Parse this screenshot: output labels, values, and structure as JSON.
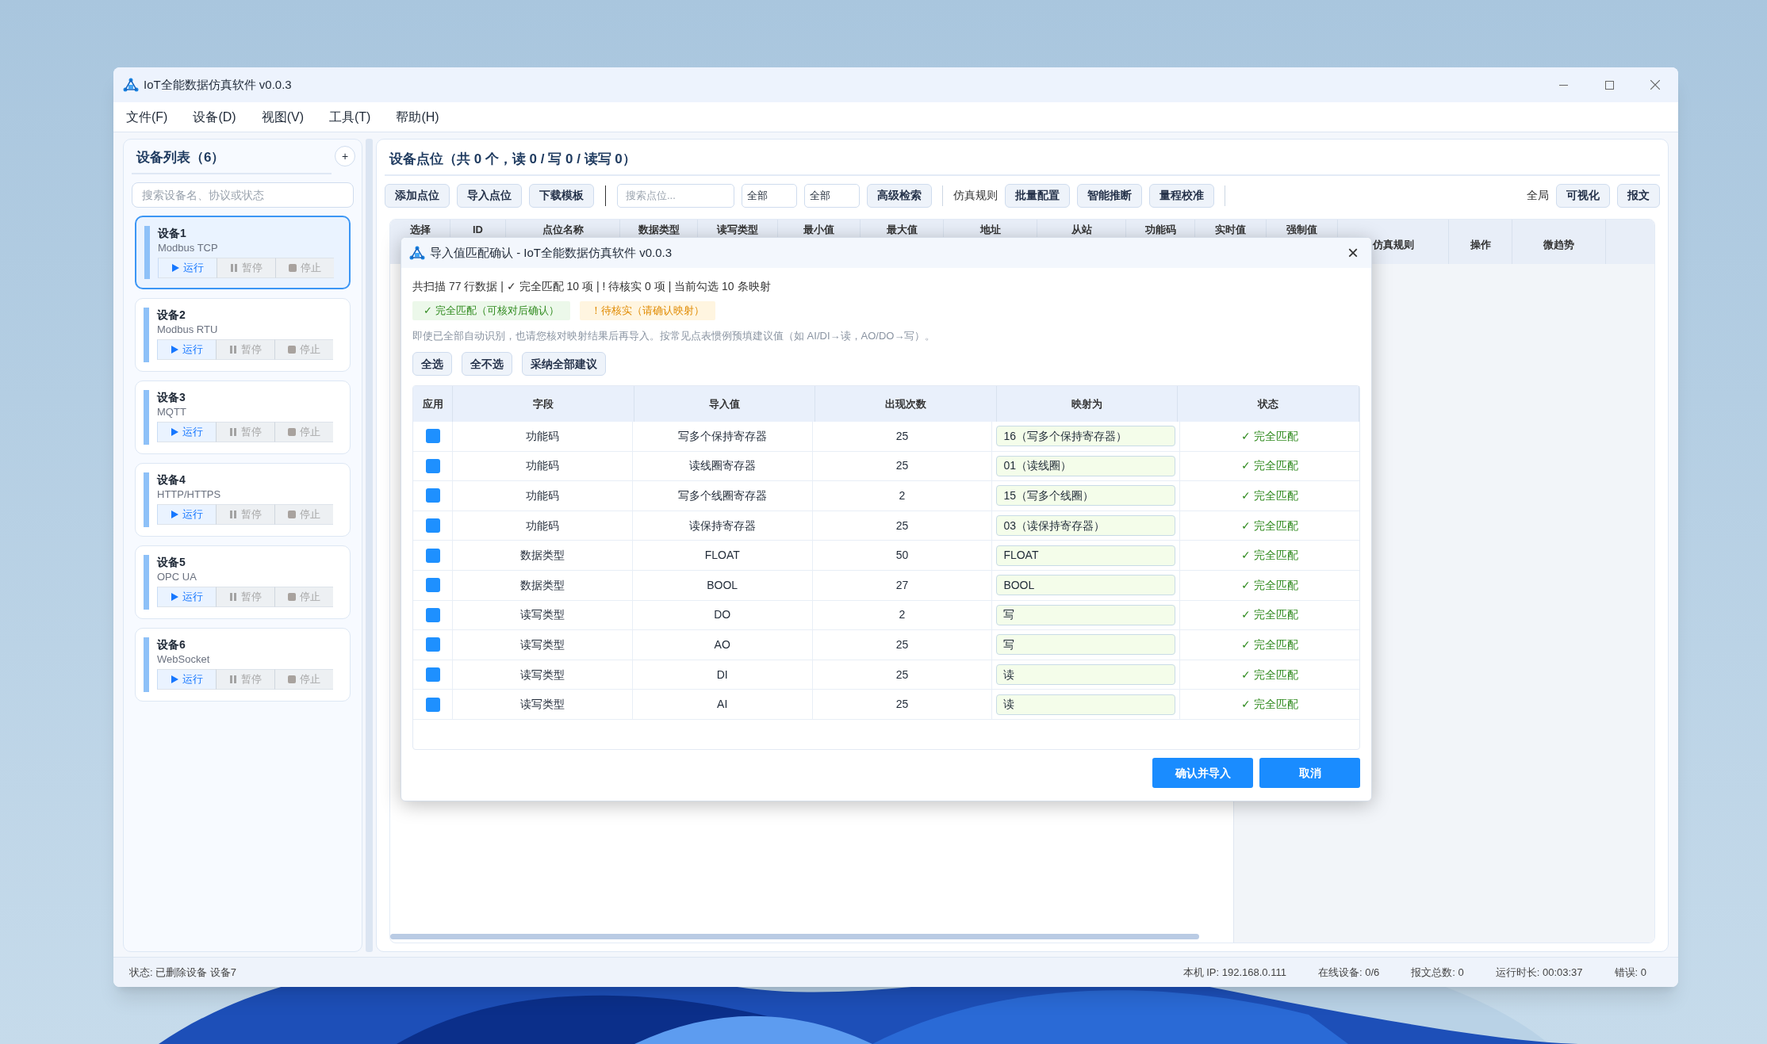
{
  "window": {
    "title": "IoT全能数据仿真软件 v0.0.3"
  },
  "menu": [
    "文件(F)",
    "设备(D)",
    "视图(V)",
    "工具(T)",
    "帮助(H)"
  ],
  "sidebar": {
    "title": "设备列表（6）",
    "add_button": "+",
    "search": {
      "placeholder": "搜索设备名、协议或状态"
    },
    "devices": [
      {
        "name": "设备1",
        "protocol": "Modbus TCP",
        "selected": true,
        "actions": [
          {
            "kind": "run",
            "label": "运行"
          },
          {
            "kind": "pause",
            "label": "暂停"
          },
          {
            "kind": "stop",
            "label": "停止"
          }
        ]
      },
      {
        "name": "设备2",
        "protocol": "Modbus RTU",
        "selected": false,
        "actions": [
          {
            "kind": "run",
            "label": "运行"
          },
          {
            "kind": "pause",
            "label": "暂停"
          },
          {
            "kind": "stop",
            "label": "停止"
          }
        ]
      },
      {
        "name": "设备3",
        "protocol": "MQTT",
        "selected": false,
        "actions": [
          {
            "kind": "run",
            "label": "运行"
          },
          {
            "kind": "pause",
            "label": "暂停"
          },
          {
            "kind": "stop",
            "label": "停止"
          }
        ]
      },
      {
        "name": "设备4",
        "protocol": "HTTP/HTTPS",
        "selected": false,
        "actions": [
          {
            "kind": "run",
            "label": "运行"
          },
          {
            "kind": "pause",
            "label": "暂停"
          },
          {
            "kind": "stop",
            "label": "停止"
          }
        ]
      },
      {
        "name": "设备5",
        "protocol": "OPC UA",
        "selected": false,
        "actions": [
          {
            "kind": "run",
            "label": "运行"
          },
          {
            "kind": "pause",
            "label": "暂停"
          },
          {
            "kind": "stop",
            "label": "停止"
          }
        ]
      },
      {
        "name": "设备6",
        "protocol": "WebSocket",
        "selected": false,
        "actions": [
          {
            "kind": "run",
            "label": "运行"
          },
          {
            "kind": "pause",
            "label": "暂停"
          },
          {
            "kind": "stop",
            "label": "停止"
          }
        ]
      }
    ]
  },
  "main": {
    "title": "设备点位（共 0 个，读 0 / 写 0 / 读写 0）",
    "toolbar": {
      "buttons": [
        "添加点位",
        "导入点位",
        "下载模板"
      ],
      "search": {
        "placeholder": "搜索点位..."
      },
      "filters": [
        "全部",
        "全部"
      ],
      "advanced": "高级检索",
      "rules_label": "仿真规则",
      "rule_buttons": [
        "批量配置",
        "智能推断",
        "量程校准"
      ],
      "scope_label": "全局",
      "view_buttons": [
        "可视化",
        "报文"
      ]
    },
    "table": {
      "columns": [
        "选择",
        "ID",
        "点位名称",
        "数据类型",
        "读写类型",
        "最小值",
        "最大值",
        "地址",
        "从站",
        "功能码",
        "实时值",
        "强制值",
        "仿真规则",
        "操作",
        "微趋势"
      ]
    }
  },
  "dialog": {
    "title": "导入值匹配确认 - IoT全能数据仿真软件 v0.0.3",
    "close": "×",
    "summary": "共扫描 77 行数据 | ✓ 完全匹配 10 项 | ! 待核实 0 项 | 当前勾选 10 条映射",
    "legend": [
      {
        "kind": "ok",
        "label": "✓ 完全匹配（可核对后确认）"
      },
      {
        "kind": "warn",
        "label": "！待核实（请确认映射）"
      }
    ],
    "note": "即使已全部自动识别，也请您核对映射结果后再导入。按常见点表惯例预填建议值（如 AI/DI→读，AO/DO→写）。",
    "buttons": [
      "全选",
      "全不选",
      "采纳全部建议"
    ],
    "columns": [
      "应用",
      "字段",
      "导入值",
      "出现次数",
      "映射为",
      "状态"
    ],
    "rows": [
      {
        "checked": true,
        "field": "功能码",
        "value": "写多个保持寄存器",
        "count": "25",
        "mapping": "16（写多个保持寄存器）",
        "status": {
          "kind": "ok",
          "label": "✓ 完全匹配"
        }
      },
      {
        "checked": true,
        "field": "功能码",
        "value": "读线圈寄存器",
        "count": "25",
        "mapping": "01（读线圈）",
        "status": {
          "kind": "ok",
          "label": "✓ 完全匹配"
        }
      },
      {
        "checked": true,
        "field": "功能码",
        "value": "写多个线圈寄存器",
        "count": "2",
        "mapping": "15（写多个线圈）",
        "status": {
          "kind": "ok",
          "label": "✓ 完全匹配"
        }
      },
      {
        "checked": true,
        "field": "功能码",
        "value": "读保持寄存器",
        "count": "25",
        "mapping": "03（读保持寄存器）",
        "status": {
          "kind": "ok",
          "label": "✓ 完全匹配"
        }
      },
      {
        "checked": true,
        "field": "数据类型",
        "value": "FLOAT",
        "count": "50",
        "mapping": "FLOAT",
        "status": {
          "kind": "ok",
          "label": "✓ 完全匹配"
        }
      },
      {
        "checked": true,
        "field": "数据类型",
        "value": "BOOL",
        "count": "27",
        "mapping": "BOOL",
        "status": {
          "kind": "ok",
          "label": "✓ 完全匹配"
        }
      },
      {
        "checked": true,
        "field": "读写类型",
        "value": "DO",
        "count": "2",
        "mapping": "写",
        "status": {
          "kind": "ok",
          "label": "✓ 完全匹配"
        }
      },
      {
        "checked": true,
        "field": "读写类型",
        "value": "AO",
        "count": "25",
        "mapping": "写",
        "status": {
          "kind": "ok",
          "label": "✓ 完全匹配"
        }
      },
      {
        "checked": true,
        "field": "读写类型",
        "value": "DI",
        "count": "25",
        "mapping": "读",
        "status": {
          "kind": "ok",
          "label": "✓ 完全匹配"
        }
      },
      {
        "checked": true,
        "field": "读写类型",
        "value": "AI",
        "count": "25",
        "mapping": "读",
        "status": {
          "kind": "ok",
          "label": "✓ 完全匹配"
        }
      }
    ],
    "footer_buttons": [
      "确认并导入",
      "取消"
    ]
  },
  "status_bar": {
    "left": "状态: 已删除设备 设备7",
    "items": [
      "本机 IP: 192.168.0.111",
      "在线设备: 0/6",
      "报文总数: 0",
      "运行时长: 00:03:37",
      "错误: 0"
    ]
  }
}
